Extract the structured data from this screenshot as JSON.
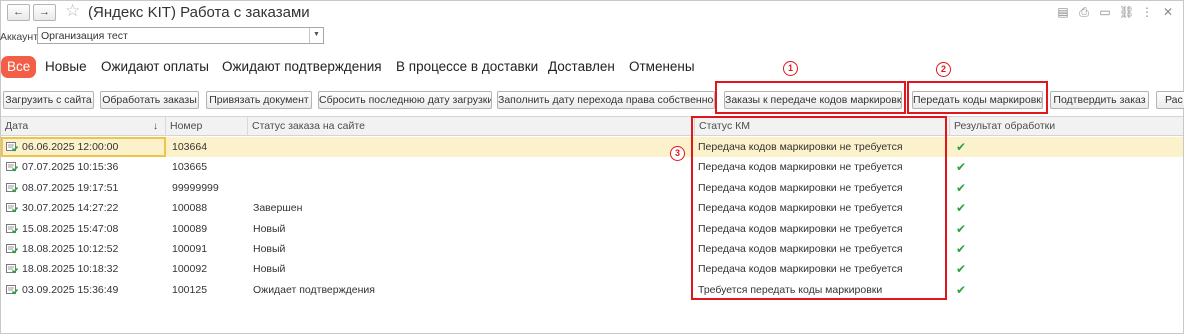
{
  "window": {
    "title": "(Яндекс KIT) Работа с заказами",
    "back_icon": "←",
    "forward_icon": "→",
    "favorite_icon": "☆",
    "tools": [
      "▤",
      "⎙",
      "▭",
      "⛓",
      "⋮",
      "✕"
    ]
  },
  "account": {
    "label": "Аккаунт:",
    "value": "Организация тест",
    "dropdown_glyph": "▼"
  },
  "tabs": [
    {
      "label": "Все",
      "active": true
    },
    {
      "label": "Новые",
      "active": false
    },
    {
      "label": "Ожидают оплаты",
      "active": false
    },
    {
      "label": "Ожидают подтверждения",
      "active": false
    },
    {
      "label": "В процессе в доставки",
      "active": false
    },
    {
      "label": "Доставлен",
      "active": false
    },
    {
      "label": "Отменены",
      "active": false
    }
  ],
  "toolbar": [
    "Загрузить с сайта",
    "Обработать заказы",
    "Привязать документ",
    "Сбросить последнюю дату загрузки",
    "Заполнить дату перехода права собственности",
    "Заказы к передаче кодов маркировки",
    "Передать коды маркировки",
    "Подтвердить заказ",
    "Рас"
  ],
  "markers": [
    "1",
    "2",
    "3"
  ],
  "table": {
    "columns": [
      "Дата",
      "Номер",
      "Статус заказа на сайте",
      "Статус КМ",
      "Результат обработки"
    ],
    "sort_indicator": "↓",
    "rows": [
      {
        "date": "06.06.2025 12:00:00",
        "number": "103664",
        "site_status": "",
        "km_status": "Передача кодов маркировки не требуется",
        "result": "✔"
      },
      {
        "date": "07.07.2025 10:15:36",
        "number": "103665",
        "site_status": "",
        "km_status": "Передача кодов маркировки не требуется",
        "result": "✔"
      },
      {
        "date": "08.07.2025 19:17:51",
        "number": "99999999",
        "site_status": "",
        "km_status": "Передача кодов маркировки не требуется",
        "result": "✔"
      },
      {
        "date": "30.07.2025 14:27:22",
        "number": "100088",
        "site_status": "Завершен",
        "km_status": "Передача кодов маркировки не требуется",
        "result": "✔"
      },
      {
        "date": "15.08.2025 15:47:08",
        "number": "100089",
        "site_status": "Новый",
        "km_status": "Передача кодов маркировки не требуется",
        "result": "✔"
      },
      {
        "date": "18.08.2025 10:12:52",
        "number": "100091",
        "site_status": "Новый",
        "km_status": "Передача кодов маркировки не требуется",
        "result": "✔"
      },
      {
        "date": "18.08.2025 10:18:32",
        "number": "100092",
        "site_status": "Новый",
        "km_status": "Передача кодов маркировки не требуется",
        "result": "✔"
      },
      {
        "date": "03.09.2025 15:36:49",
        "number": "100125",
        "site_status": "Ожидает подтверждения",
        "km_status": "Требуется передать коды маркировки",
        "result": "✔"
      }
    ],
    "selected_row": 0
  },
  "colors": {
    "accent": "#f25f46",
    "annotation": "#e0161d",
    "selected_row": "#fbf2cc",
    "check": "#2aa33c"
  }
}
